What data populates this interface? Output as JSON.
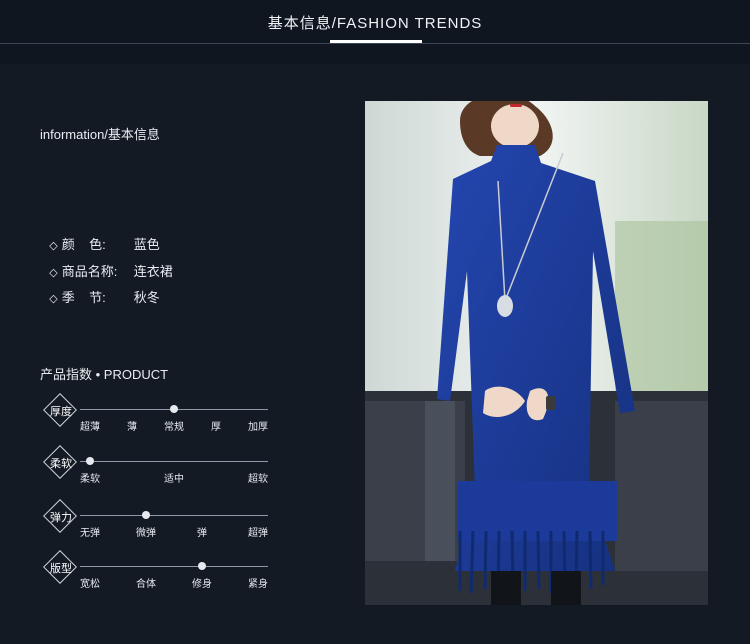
{
  "header": {
    "title": "基本信息/FASHION TRENDS"
  },
  "info": {
    "heading": "information/基本信息",
    "attributes": [
      {
        "bullet": "◇",
        "label": "颜    色:",
        "value": "蓝色"
      },
      {
        "bullet": "◇",
        "label": "商品名称:",
        "value": "连衣裙"
      },
      {
        "bullet": "◇",
        "label": "季    节:",
        "value": "秋冬"
      }
    ]
  },
  "product": {
    "heading": "产品指数 • PRODUCT",
    "scales": [
      {
        "badge": "厚度",
        "options": [
          "超薄",
          "薄",
          "常规",
          "厚",
          "加厚"
        ],
        "selected_index": 2
      },
      {
        "badge": "柔软",
        "options": [
          "柔软",
          "适中",
          "超软"
        ],
        "selected_index": 0
      },
      {
        "badge": "弹力",
        "options": [
          "无弹",
          "微弹",
          "弹",
          "超弹"
        ],
        "selected_index": 1
      },
      {
        "badge": "版型",
        "options": [
          "宽松",
          "合体",
          "修身",
          "紧身"
        ],
        "selected_index": 2
      }
    ]
  },
  "photo": {
    "subject": "woman-in-blue-knit-dress-photo"
  },
  "colors": {
    "background": "#131a24",
    "dress": "#1d3a9a"
  }
}
